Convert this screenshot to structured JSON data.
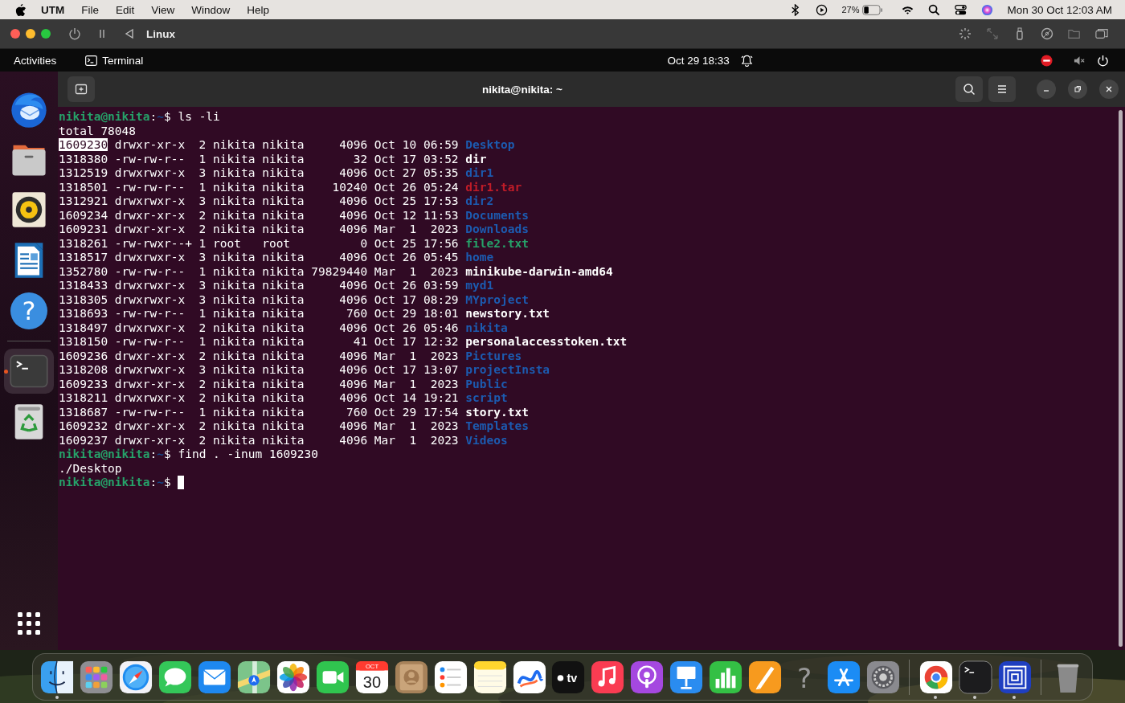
{
  "menubar": {
    "app": "UTM",
    "menus": [
      "File",
      "Edit",
      "View",
      "Window",
      "Help"
    ],
    "battery_percent": "27%",
    "clock": "Mon 30 Oct  12:03 AM"
  },
  "vm_window": {
    "title": "Linux"
  },
  "gnome_bar": {
    "activities": "Activities",
    "app": "Terminal",
    "clock": "Oct 29  18:33"
  },
  "launcher": [
    {
      "kind": "thunderbird",
      "selected": false,
      "running": false
    },
    {
      "kind": "files",
      "selected": false,
      "running": false
    },
    {
      "kind": "rhythmbox",
      "selected": false,
      "running": false
    },
    {
      "kind": "writer",
      "selected": false,
      "running": false
    },
    {
      "kind": "help",
      "glyph": "?",
      "selected": false,
      "running": false
    },
    {
      "kind": "separator"
    },
    {
      "kind": "terminal",
      "selected": true,
      "running": true
    },
    {
      "kind": "trash",
      "selected": false,
      "running": false
    }
  ],
  "terminal": {
    "title": "nikita@nikita: ~",
    "lines": [
      {
        "kind": "prompt",
        "user": "nikita@nikita",
        "sep": ":",
        "path": "~",
        "sign": "$",
        "command": "ls -li",
        "cursor": false
      },
      {
        "kind": "output",
        "text": "total 78048"
      },
      {
        "kind": "entry",
        "inode": "1609230",
        "selected": true,
        "info": "drwxr-xr-x  2 nikita nikita     4096 Oct 10 06:59",
        "name": "Desktop",
        "color": "#1c5bb0"
      },
      {
        "kind": "entry",
        "inode": "1318380",
        "selected": false,
        "info": "-rw-rw-r--  1 nikita nikita       32 Oct 17 03:52",
        "name": "dir",
        "color": "#ffffff"
      },
      {
        "kind": "entry",
        "inode": "1312519",
        "selected": false,
        "info": "drwxrwxr-x  3 nikita nikita     4096 Oct 27 05:35",
        "name": "dir1",
        "color": "#1c5bb0"
      },
      {
        "kind": "entry",
        "inode": "1318501",
        "selected": false,
        "info": "-rw-rw-r--  1 nikita nikita    10240 Oct 26 05:24",
        "name": "dir1.tar",
        "color": "#c01c28"
      },
      {
        "kind": "entry",
        "inode": "1312921",
        "selected": false,
        "info": "drwxrwxr-x  3 nikita nikita     4096 Oct 25 17:53",
        "name": "dir2",
        "color": "#1c5bb0"
      },
      {
        "kind": "entry",
        "inode": "1609234",
        "selected": false,
        "info": "drwxr-xr-x  2 nikita nikita     4096 Oct 12 11:53",
        "name": "Documents",
        "color": "#1c5bb0"
      },
      {
        "kind": "entry",
        "inode": "1609231",
        "selected": false,
        "info": "drwxr-xr-x  2 nikita nikita     4096 Mar  1  2023",
        "name": "Downloads",
        "color": "#1c5bb0"
      },
      {
        "kind": "entry",
        "inode": "1318261",
        "selected": false,
        "info": "-rw-rwxr--+ 1 root   root          0 Oct 25 17:56",
        "name": "file2.txt",
        "color": "#26a269"
      },
      {
        "kind": "entry",
        "inode": "1318517",
        "selected": false,
        "info": "drwxrwxr-x  3 nikita nikita     4096 Oct 26 05:45",
        "name": "home",
        "color": "#1c5bb0"
      },
      {
        "kind": "entry",
        "inode": "1352780",
        "selected": false,
        "info": "-rw-rw-r--  1 nikita nikita 79829440 Mar  1  2023",
        "name": "minikube-darwin-amd64",
        "color": "#ffffff"
      },
      {
        "kind": "entry",
        "inode": "1318433",
        "selected": false,
        "info": "drwxrwxr-x  3 nikita nikita     4096 Oct 26 03:59",
        "name": "myd1",
        "color": "#1c5bb0"
      },
      {
        "kind": "entry",
        "inode": "1318305",
        "selected": false,
        "info": "drwxrwxr-x  3 nikita nikita     4096 Oct 17 08:29",
        "name": "MYproject",
        "color": "#1c5bb0"
      },
      {
        "kind": "entry",
        "inode": "1318693",
        "selected": false,
        "info": "-rw-rw-r--  1 nikita nikita      760 Oct 29 18:01",
        "name": "newstory.txt",
        "color": "#ffffff"
      },
      {
        "kind": "entry",
        "inode": "1318497",
        "selected": false,
        "info": "drwxrwxr-x  2 nikita nikita     4096 Oct 26 05:46",
        "name": "nikita",
        "color": "#1c5bb0"
      },
      {
        "kind": "entry",
        "inode": "1318150",
        "selected": false,
        "info": "-rw-rw-r--  1 nikita nikita       41 Oct 17 12:32",
        "name": "personalaccesstoken.txt",
        "color": "#ffffff"
      },
      {
        "kind": "entry",
        "inode": "1609236",
        "selected": false,
        "info": "drwxr-xr-x  2 nikita nikita     4096 Mar  1  2023",
        "name": "Pictures",
        "color": "#1c5bb0"
      },
      {
        "kind": "entry",
        "inode": "1318208",
        "selected": false,
        "info": "drwxrwxr-x  3 nikita nikita     4096 Oct 17 13:07",
        "name": "projectInsta",
        "color": "#1c5bb0"
      },
      {
        "kind": "entry",
        "inode": "1609233",
        "selected": false,
        "info": "drwxr-xr-x  2 nikita nikita     4096 Mar  1  2023",
        "name": "Public",
        "color": "#1c5bb0"
      },
      {
        "kind": "entry",
        "inode": "1318211",
        "selected": false,
        "info": "drwxrwxr-x  2 nikita nikita     4096 Oct 14 19:21",
        "name": "script",
        "color": "#1c5bb0"
      },
      {
        "kind": "entry",
        "inode": "1318687",
        "selected": false,
        "info": "-rw-rw-r--  1 nikita nikita      760 Oct 29 17:54",
        "name": "story.txt",
        "color": "#ffffff"
      },
      {
        "kind": "entry",
        "inode": "1609232",
        "selected": false,
        "info": "drwxr-xr-x  2 nikita nikita     4096 Mar  1  2023",
        "name": "Templates",
        "color": "#1c5bb0"
      },
      {
        "kind": "entry",
        "inode": "1609237",
        "selected": false,
        "info": "drwxr-xr-x  2 nikita nikita     4096 Mar  1  2023",
        "name": "Videos",
        "color": "#1c5bb0"
      },
      {
        "kind": "prompt",
        "user": "nikita@nikita",
        "sep": ":",
        "path": "~",
        "sign": "$",
        "command": "find . -inum 1609230",
        "cursor": false
      },
      {
        "kind": "output",
        "text": "./Desktop"
      },
      {
        "kind": "prompt",
        "user": "nikita@nikita",
        "sep": ":",
        "path": "~",
        "sign": "$",
        "cursor": true
      }
    ]
  },
  "dock": [
    {
      "kind": "finder",
      "running": true
    },
    {
      "kind": "launchpad",
      "running": false
    },
    {
      "kind": "safari",
      "running": false
    },
    {
      "kind": "messages",
      "running": false
    },
    {
      "kind": "mail",
      "running": false
    },
    {
      "kind": "maps",
      "running": false
    },
    {
      "kind": "photos",
      "running": false
    },
    {
      "kind": "facetime",
      "running": false
    },
    {
      "kind": "calendar",
      "month": "OCT",
      "day": "30",
      "running": false
    },
    {
      "kind": "contacts",
      "running": false
    },
    {
      "kind": "reminders",
      "running": false
    },
    {
      "kind": "notes",
      "running": false
    },
    {
      "kind": "freeform",
      "running": false
    },
    {
      "kind": "tv",
      "glyph": "tv",
      "running": false
    },
    {
      "kind": "music",
      "running": false
    },
    {
      "kind": "podcasts",
      "running": false
    },
    {
      "kind": "keynote",
      "running": false
    },
    {
      "kind": "numbers",
      "running": false
    },
    {
      "kind": "pages",
      "running": false
    },
    {
      "kind": "tips",
      "glyph": "?",
      "running": false
    },
    {
      "kind": "appstore",
      "running": false
    },
    {
      "kind": "settings",
      "running": false
    },
    {
      "kind": "separator"
    },
    {
      "kind": "chrome",
      "running": true
    },
    {
      "kind": "terminal",
      "running": true
    },
    {
      "kind": "utm",
      "running": true
    },
    {
      "kind": "separator"
    },
    {
      "kind": "trash",
      "running": false
    }
  ]
}
